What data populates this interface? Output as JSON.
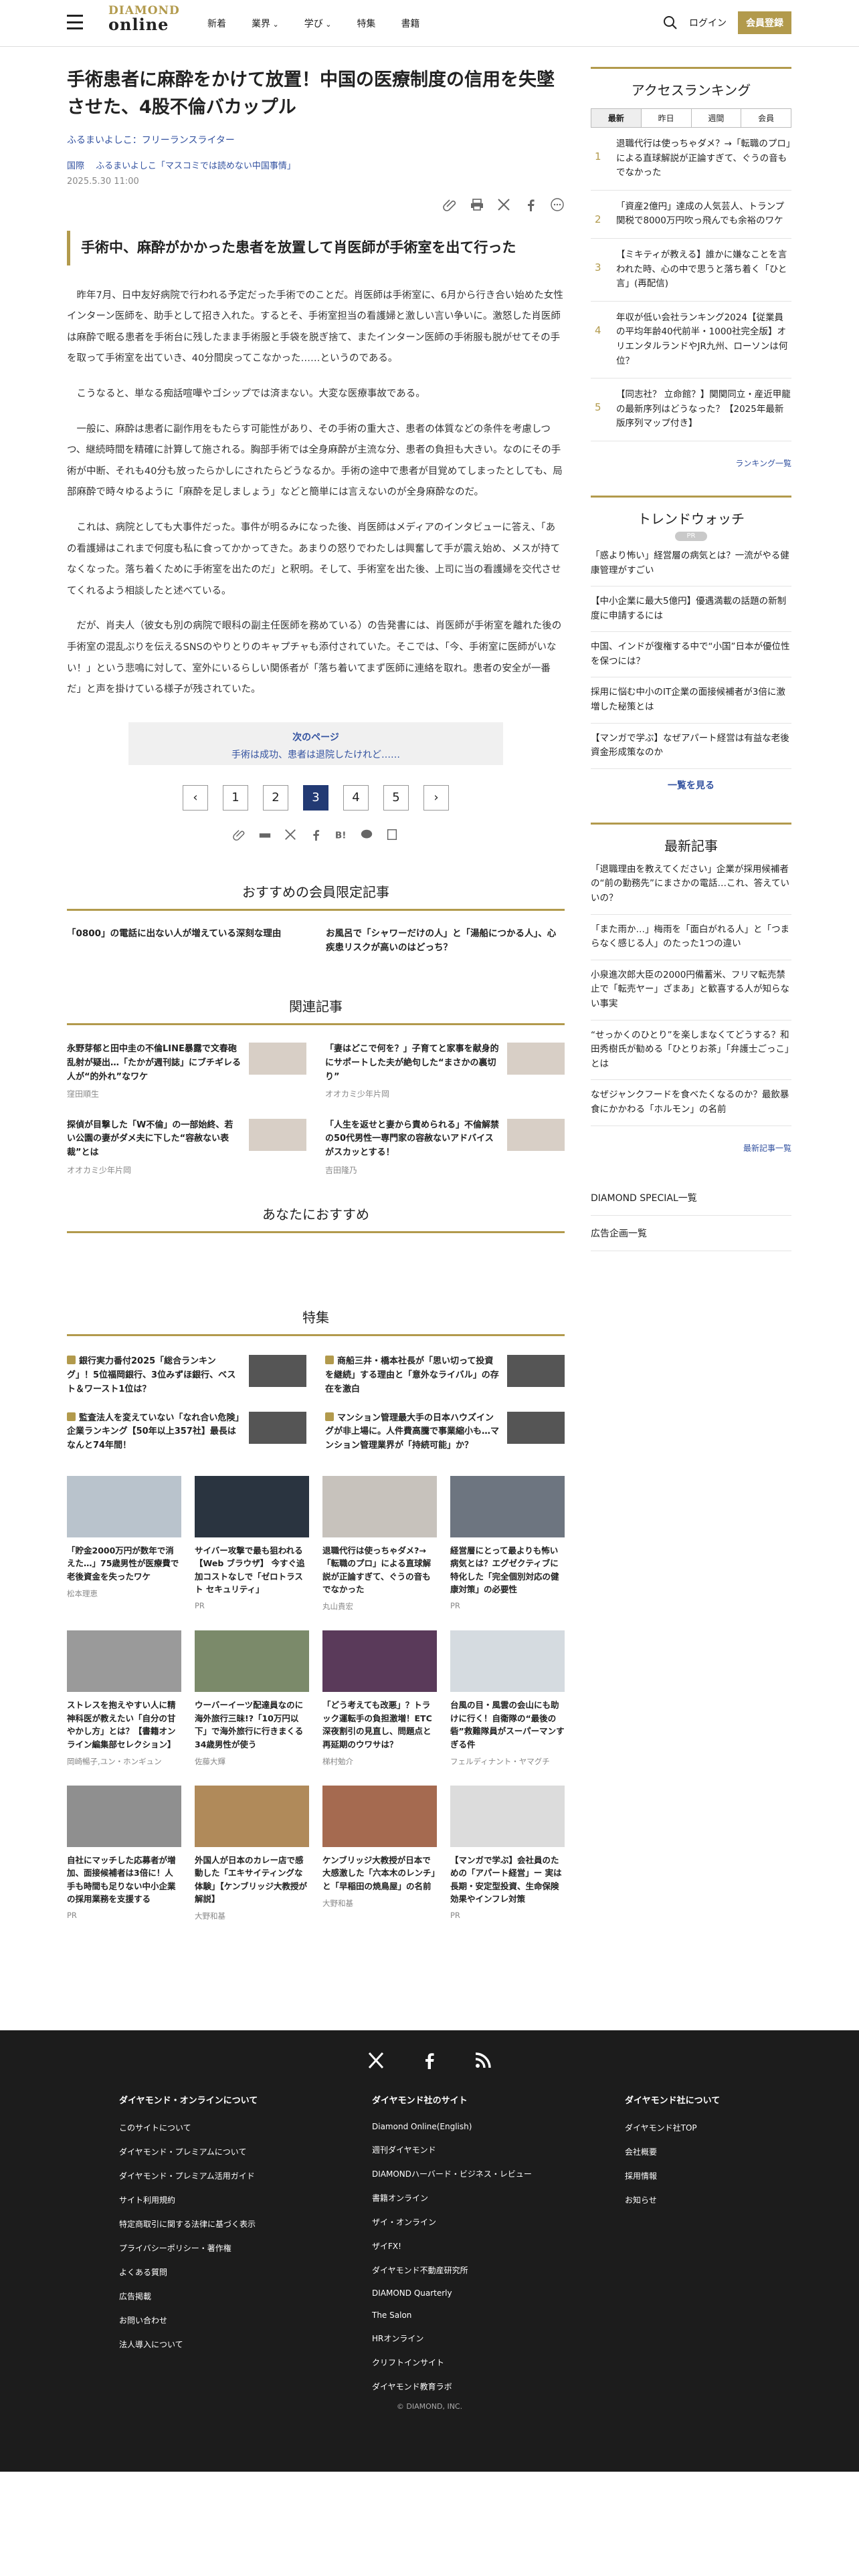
{
  "header": {
    "logo_top": "DIAMOND",
    "logo_bottom": "online",
    "nav": [
      "新着",
      "業界",
      "学び",
      "特集",
      "書籍"
    ],
    "login": "ログイン",
    "register": "会員登録"
  },
  "article": {
    "title": "手術患者に麻酔をかけて放置！中国の医療制度の信用を失墜させた、4股不倫バカップル",
    "author": "ふるまいよしこ：フリーランスライター",
    "tag1": "国際",
    "tag2": "ふるまいよしこ「マスコミでは読めない中国事情」",
    "date": "2025.5.30 11:00",
    "subhead": "手術中、麻酔がかかった患者を放置して肖医師が手術室を出て行った",
    "paragraphs": [
      "昨年7月、日中友好病院で行われる予定だった手術でのことだ。肖医師は手術室に、6月から行き合い始めた女性インターン医師を、助手として招き入れた。するとそ、手術室担当の看護婦と激しい言い争いに。激怒した肖医師は麻酔で眠る患者を手術台に残したまま手術服と手袋を脱ぎ捨て、またインターン医師の手術服も脱がせてその手を取って手術室を出ていき、40分間戻ってこなかった……というのである。",
      "こうなると、単なる痴話喧嘩やゴシップでは済まない。大変な医療事故である。",
      "一般に、麻酔は患者に副作用をもたらす可能性があり、その手術の重大さ、患者の体質などの条件を考慮しつつ、継続時間を精確に計算して施される。胸部手術では全身麻酔が主流な分、患者の負担も大きい。なのにその手術が中断、それも40分も放ったらかしにされたらどうなるか。手術の途中で患者が目覚めてしまったとしても、局部麻酔で時々ゆるように「麻酔を足しましょう」などと簡単には言えないのが全身麻酔なのだ。",
      "これは、病院としても大事件だった。事件が明るみになった後、肖医師はメディアのインタビューに答え、「あの看護婦はこれまで何度も私に食ってかかってきた。あまりの怒りでわたしは興奮して手が震え始め、メスが持てなくなった。落ち着くために手術室を出たのだ」と釈明。そして、手術室を出た後、上司に当の看護婦を交代させてくれるよう相談したと述べている。",
      "だが、肖夫人（彼女も別の病院で眼科の副主任医師を務めている）の告発書には、肖医師が手術室を離れた後の手術室の混乱ぶりを伝えるSNSのやりとりのキャプチャも添付されていた。そこでは、「今、手術室に医師がいない！」という悲鳴に対して、室外にいるらしい関係者が「落ち着いてまず医師に連絡を取れ。患者の安全が一番だ」と声を掛けている様子が残されていた。"
    ],
    "next_label": "次のページ",
    "next_title": "手術は成功、患者は退院したけれど……",
    "pages": [
      "1",
      "2",
      "3",
      "4",
      "5"
    ]
  },
  "recommend": {
    "title": "おすすめの会員限定記事",
    "items": [
      "「0800」の電話に出ない人が増えている深刻な理由",
      "お風呂で「シャワーだけの人」と「湯船につかる人」、心疾患リスクが高いのはどっち？"
    ]
  },
  "related": {
    "title": "関連記事",
    "items": [
      {
        "title": "永野芽郁と田中圭の不倫LINE暴露で文春砲乱射が疑出…「たかが週刊誌」にブチギレる人が“的外れ”なワケ",
        "author": "窪田順生"
      },
      {
        "title": "「妻はどこで何を？」子育てと家事を献身的にサポートした夫が絶句した“まさかの裏切り”",
        "author": "オオカミ少年片岡"
      },
      {
        "title": "探偵が目撃した「W不倫」の一部始終、若い公園の妻がダメ夫に下した“容赦ない表裁”とは",
        "author": "オオカミ少年片岡"
      },
      {
        "title": "「人生を返せと妻から責められる」不倫解禁の50代男性一専門家の容赦ないアドバイスがスカッとする！",
        "author": "吉田隆乃"
      }
    ]
  },
  "foryou": {
    "title": "あなたにおすすめ"
  },
  "feature": {
    "title": "特集",
    "items": [
      "銀行実力番付2025「総合ランキング」！5位福岡銀行、3位みずほ銀行、ベスト＆ワースト1位は？",
      "商船三井・橋本社長が「思い切って投資を継続」する理由と「意外なライバル」の存在を激白",
      "監査法人を変えていない「なれ合い危険」企業ランキング【50年以上357社】最長はなんと74年間！",
      "マンション管理最大手の日本ハウズイングが非上場に。人件費高騰で事業縮小も…マンション管理業界が「持続可能」か？"
    ]
  },
  "cards": [
    {
      "title": "「貯金2000万円が数年で消えた…」75歳男性が医療費で老後資金を失ったワケ",
      "author": "松本理恵"
    },
    {
      "title": "サイバー攻撃で最も狙われる【Web ブラウザ】 今すぐ追加コストなしで「ゼロトラスト セキュリティ」",
      "author": "PR"
    },
    {
      "title": "退職代行は使っちゃダメ?→「転職のプロ」による直球解説が正論すぎて、ぐうの音もでなかった",
      "author": "丸山貴宏"
    },
    {
      "title": "経営層にとって最よりも怖い病気とは？エグゼクティブに特化した「完全個別対応の健康対策」の必要性",
      "author": "PR"
    },
    {
      "title": "ストレスを抱えやすい人に精神科医が教えたい「自分の甘やかし方」とは？【書籍オンライン編集部セレクション】",
      "author": "岡崎暢子,ユン・ホンギュン"
    },
    {
      "title": "ウーバーイーツ配達員なのに海外旅行三昧!?「10万円以下」で海外旅行に行きまくる34歳男性が使う",
      "author": "佐藤大輝"
    },
    {
      "title": "「どう考えても改悪」？トラック運転手の負担激増！ETC深夜割引の見直し、問題点と再延期のウワサは？",
      "author": "梯村勉介"
    },
    {
      "title": "台風の目・風雲の会山にも助けに行く！自衛隊の“最後の砦”救難隊員がスーパーマンすぎる件",
      "author": "フェルディナント・ヤマグチ"
    },
    {
      "title": "自社にマッチした応募者が増加、面接候補者は3倍に！人手も時間も足りない中小企業の採用業務を支援する",
      "author": "PR"
    },
    {
      "title": "外国人が日本のカレー店で感動した「エキサイティングな体験」【ケンブリッジ大教授が解説】",
      "author": "大野和基"
    },
    {
      "title": "ケンブリッジ大教授が日本で大感激した「六本木のレンチ」と「早稲田の焼鳥屋」の名前",
      "author": "大野和基"
    },
    {
      "title": "【マンガで学ぶ】会社員のための「アパート経営」ー 実は長期・安定型投資、生命保険効果やインフレ対策",
      "author": "PR"
    }
  ],
  "sidebar": {
    "ranking_title": "アクセスランキング",
    "ranking_tabs": [
      "最新",
      "昨日",
      "週間",
      "会員"
    ],
    "ranking": [
      {
        "n": "1",
        "title": "退職代行は使っちゃダメ？→「転職のプロ」による直球解説が正論すぎて、ぐうの音もでなかった"
      },
      {
        "n": "2",
        "title": "「資産2億円」達成の人気芸人、トランプ関税で8000万円吹っ飛んでも余裕のワケ"
      },
      {
        "n": "3",
        "title": "【ミキティが教える】誰かに嫌なことを言われた時、心の中で思うと落ち着く「ひと言」(再配信)"
      },
      {
        "n": "4",
        "title": "年収が低い会社ランキング2024【従業員の平均年齢40代前半・1000社完全版】オリエンタルランドやJR九州、ローソンは何位？"
      },
      {
        "n": "5",
        "title": "【同志社？ 立命館？】関関同立・産近甲龍の最新序列はどうなった？【2025年最新版序列マップ付き】"
      }
    ],
    "ranking_more": "ランキング一覧",
    "trend_title": "トレンドウォッチ",
    "trend_badge": "PR",
    "trend": [
      "「惑より怖い」経営層の病気とは？一流がやる健康管理がすごい",
      "【中小企業に最大5億円】優遇満載の話題の新制度に申請するには",
      "中国、インドが復権する中で“小国”日本が優位性を保つには？",
      "採用に悩む中小のIT企業の面接候補者が3倍に激増した秘策とは",
      "【マンガで学ぶ】なぜアパート経営は有益な老後資金形成策なのか"
    ],
    "trend_more": "一覧を見る",
    "latest_title": "最新記事",
    "latest": [
      "「退職理由を教えてください」企業が採用候補者の“前の勤務先”にまさかの電話…これ、答えていいの？",
      "「また雨か…」梅雨を「面白がれる人」と「つまらなく感じる人」のたった1つの違い",
      "小泉進次郎大臣の2000円備蓄米、フリマ転売禁止で「転売ヤー」ざまあ」と歓喜する人が知らない事実",
      "“せっかくのひとり”を楽しまなくてどうする？和田秀樹氏が勧める「ひとりお茶」「弁護士ごっこ」とは",
      "なぜジャンクフードを食べたくなるのか？最飲暴食にかかわる「ホルモン」の名前"
    ],
    "latest_more": "最新記事一覧",
    "special": "DIAMOND SPECIAL一覧",
    "ads": "広告企画一覧"
  },
  "footer": {
    "col1_title": "ダイヤモンド・オンラインについて",
    "col1": [
      "このサイトについて",
      "ダイヤモンド・プレミアムについて",
      "ダイヤモンド・プレミアム活用ガイド",
      "サイト利用規約",
      "特定商取引に関する法律に基づく表示",
      "プライバシーポリシー・著作権",
      "よくある質問",
      "広告掲載",
      "お問い合わせ",
      "法人導入について"
    ],
    "col2_title": "ダイヤモンド社のサイト",
    "col2": [
      "Diamond Online(English)",
      "週刊ダイヤモンド",
      "DIAMONDハーバード・ビジネス・レビュー",
      "書籍オンライン",
      "ザイ・オンライン",
      "ザイFX!",
      "ダイヤモンド不動産研究所",
      "DIAMOND Quarterly",
      "The Salon",
      "HRオンライン",
      "クリフトインサイト",
      "ダイヤモンド教育ラボ"
    ],
    "col3_title": "ダイヤモンド社について",
    "col3": [
      "ダイヤモンド社TOP",
      "会社概要",
      "採用情報",
      "お知らせ"
    ],
    "copyright": "© DIAMOND, INC."
  }
}
